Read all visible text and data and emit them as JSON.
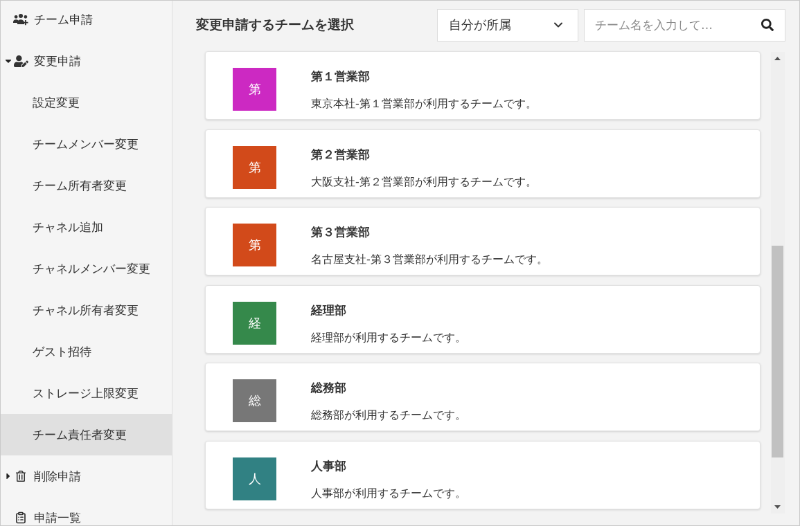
{
  "sidebar": {
    "items": [
      {
        "kind": "link",
        "label": "チーム申請",
        "selected": false
      },
      {
        "kind": "group",
        "label": "変更申請",
        "expanded": true,
        "selected": false,
        "children": [
          {
            "label": "設定変更",
            "selected": false
          },
          {
            "label": "チームメンバー変更",
            "selected": false
          },
          {
            "label": "チーム所有者変更",
            "selected": false
          },
          {
            "label": "チャネル追加",
            "selected": false
          },
          {
            "label": "チャネルメンバー変更",
            "selected": false
          },
          {
            "label": "チャネル所有者変更",
            "selected": false
          },
          {
            "label": "ゲスト招待",
            "selected": false
          },
          {
            "label": "ストレージ上限変更",
            "selected": false
          },
          {
            "label": "チーム責任者変更",
            "selected": true
          }
        ]
      },
      {
        "kind": "group",
        "label": "削除申請",
        "expanded": false,
        "selected": false
      },
      {
        "kind": "link",
        "label": "申請一覧",
        "selected": false
      }
    ]
  },
  "header": {
    "title": "変更申請するチームを選択"
  },
  "filter": {
    "value": "自分が所属"
  },
  "search": {
    "placeholder": "チーム名を入力して…"
  },
  "teams": [
    {
      "initial": "第",
      "name": "第１営業部",
      "description": "東京本社-第１営業部が利用するチームです。",
      "color": "#cc29c2"
    },
    {
      "initial": "第",
      "name": "第２営業部",
      "description": "大阪支社-第２営業部が利用するチームです。",
      "color": "#d24a1a"
    },
    {
      "initial": "第",
      "name": "第３営業部",
      "description": "名古屋支社-第３営業部が利用するチームです。",
      "color": "#d24a1a"
    },
    {
      "initial": "経",
      "name": "経理部",
      "description": "経理部が利用するチームです。",
      "color": "#35894b"
    },
    {
      "initial": "総",
      "name": "総務部",
      "description": "総務部が利用するチームです。",
      "color": "#777777"
    },
    {
      "initial": "人",
      "name": "人事部",
      "description": "人事部が利用するチームです。",
      "color": "#318183"
    }
  ]
}
